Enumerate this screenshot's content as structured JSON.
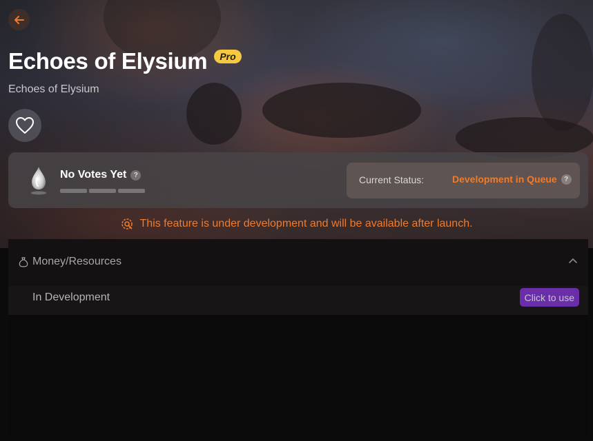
{
  "header": {
    "back_icon": "arrow-left-icon",
    "title": "Echoes of Elysium",
    "badge": "Pro",
    "subtitle": "Echoes of Elysium",
    "favorite_icon": "heart-icon"
  },
  "votes": {
    "icon": "flame-drop-icon",
    "label": "No Votes Yet",
    "help": "?",
    "bars": 3
  },
  "status": {
    "label": "Current Status:",
    "value": "Development in Queue",
    "help": "?"
  },
  "notice": {
    "icon": "gear-wrench-icon",
    "text": "This feature is under development and will be available after launch."
  },
  "section": {
    "icon": "money-bag-icon",
    "title": "Money/Resources",
    "collapse_icon": "chevron-up-icon",
    "features": [
      {
        "name": "In Development",
        "action_label": "Click to use"
      }
    ]
  },
  "colors": {
    "accent_orange": "#f07b2c",
    "pro_yellow": "#f5c842",
    "button_purple": "#6a2fa8"
  }
}
